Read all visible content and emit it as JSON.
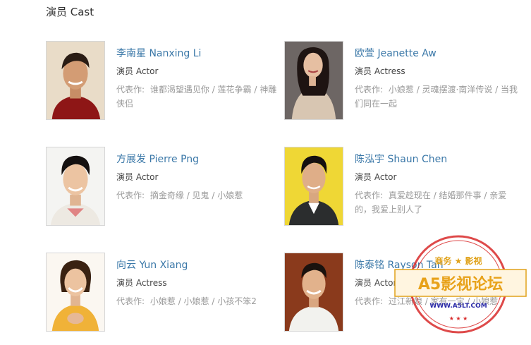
{
  "section": {
    "title": "演员 Cast"
  },
  "cast": [
    {
      "name": "李南星 Nanxing Li",
      "role": "演员 Actor",
      "works_label": "代表作:",
      "works": "谁都渴望遇见你 / 莲花争霸 / 神雕侠侣"
    },
    {
      "name": "欧萱 Jeanette Aw",
      "role": "演员 Actress",
      "works_label": "代表作:",
      "works": "小娘惹 / 灵魂摆渡·南洋传说 / 当我们同在一起"
    },
    {
      "name": "方展发 Pierre Png",
      "role": "演员 Actor",
      "works_label": "代表作:",
      "works": "摘金奇缘 / 见鬼 / 小娘惹"
    },
    {
      "name": "陈泓宇 Shaun Chen",
      "role": "演员 Actor",
      "works_label": "代表作:",
      "works": "真爱趁现在 / 结婚那件事 / 亲爱的，我爱上别人了"
    },
    {
      "name": "向云 Yun Xiang",
      "role": "演员 Actress",
      "works_label": "代表作:",
      "works": "小娘惹 / 小娘惹 / 小孩不笨2"
    },
    {
      "name": "陈泰铭 Rayson Tan",
      "role": "演员 Actor",
      "works_label": "代表作:",
      "works": "过江新娘 / 家有一宝 / 小娘惹"
    }
  ],
  "watermark": {
    "text_main": "A5影视论坛",
    "text_top": "商务 ★ 影视",
    "url": "WWW.A5LT.COM"
  }
}
